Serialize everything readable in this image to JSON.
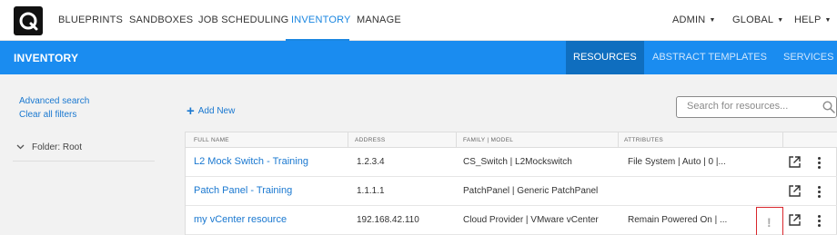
{
  "topnav": {
    "items": [
      "BLUEPRINTS",
      "SANDBOXES",
      "JOB SCHEDULING",
      "INVENTORY",
      "MANAGE"
    ],
    "active": "INVENTORY",
    "right_items": [
      "ADMIN",
      "GLOBAL",
      "HELP"
    ]
  },
  "subbar": {
    "title": "INVENTORY",
    "tabs": [
      "RESOURCES",
      "ABSTRACT TEMPLATES",
      "SERVICES"
    ],
    "active_tab": "RESOURCES"
  },
  "left": {
    "advanced_search": "Advanced search",
    "clear_filters": "Clear all filters",
    "folder": "Folder: Root"
  },
  "main": {
    "add_new": "Add New",
    "search_placeholder": "Search for resources..."
  },
  "table": {
    "columns": [
      "FULL NAME",
      "ADDRESS",
      "FAMILY | MODEL",
      "ATTRIBUTES"
    ],
    "rows": [
      {
        "name": "L2 Mock Switch - Training",
        "address": "1.2.3.4",
        "family_model": "CS_Switch | L2Mockswitch",
        "attributes": "File System | Auto | 0 |..."
      },
      {
        "name": "Patch Panel - Training",
        "address": "1.1.1.1",
        "family_model": "PatchPanel | Generic PatchPanel",
        "attributes": ""
      },
      {
        "name": "my vCenter resource",
        "address": "192.168.42.110",
        "family_model": "Cloud Provider | VMware vCenter",
        "attributes": "Remain Powered On | ...",
        "warning": "!"
      }
    ]
  },
  "colors": {
    "accent": "#1a8cf0",
    "active_tab_bg": "#0f6ebf",
    "link": "#1a78d0",
    "warning_border": "#d9262c"
  }
}
